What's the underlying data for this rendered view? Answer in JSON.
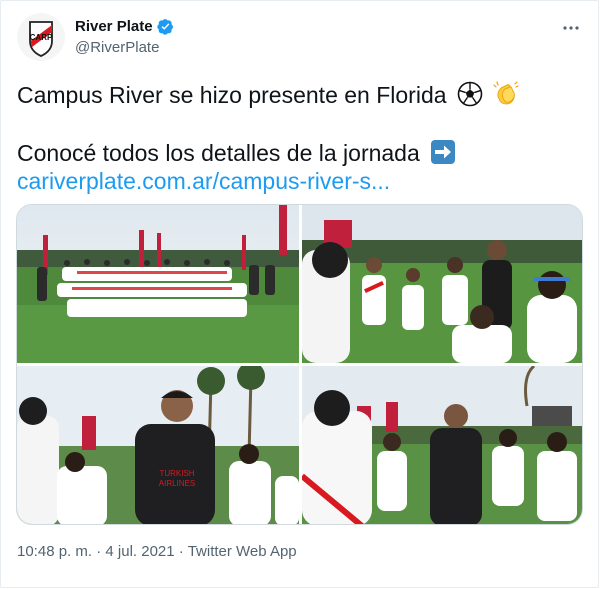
{
  "tweet": {
    "display_name": "River Plate",
    "handle": "@RiverPlate",
    "line1": "Campus River se hizo presente en Florida",
    "line2": "Conocé todos los detalles de la jornada",
    "link": "cariverplate.com.ar/campus-river-s...",
    "time": "10:48 p. m.",
    "separator": "·",
    "date": "4 jul. 2021",
    "source": "Twitter Web App"
  },
  "badge_text": "CARP",
  "colors": {
    "link": "#1d9bf0",
    "verified": "#1d9bf0",
    "brand_red": "#d71920",
    "muted": "#536471"
  },
  "icons": [
    "soccer-ball-icon",
    "clapping-hands-icon",
    "right-arrow-icon",
    "verified-icon",
    "more-icon"
  ]
}
